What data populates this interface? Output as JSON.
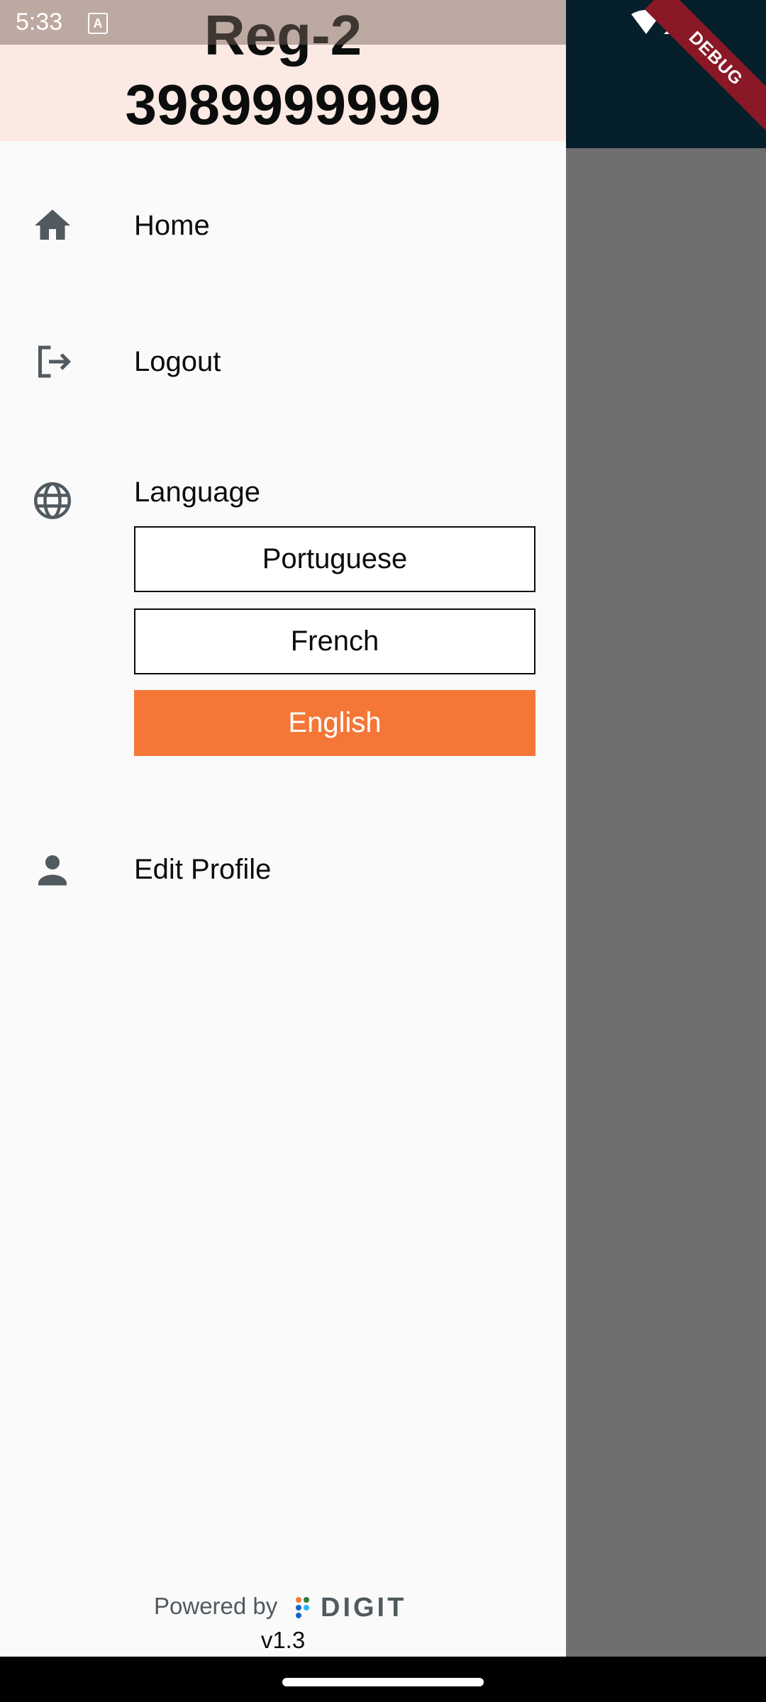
{
  "status_bar": {
    "time": "5:33",
    "notification_icon": "a-icon",
    "wifi_icon": "wifi-icon",
    "signal_icon": "signal-icon"
  },
  "debug_banner": "DEBUG",
  "drawer": {
    "header": {
      "name": "Reg-2",
      "phone": "3989999999"
    },
    "menu": {
      "home": {
        "label": "Home",
        "icon": "home-icon"
      },
      "logout": {
        "label": "Logout",
        "icon": "logout-icon"
      },
      "language": {
        "label": "Language",
        "icon": "globe-icon"
      },
      "edit_profile": {
        "label": "Edit Profile",
        "icon": "person-icon"
      }
    },
    "languages": {
      "options": [
        "Portuguese",
        "French",
        "English"
      ],
      "selected": "English"
    },
    "footer": {
      "powered_by": "Powered by",
      "brand": "DIGIT",
      "version": "v1.3"
    }
  },
  "colors": {
    "app_bar": "#06202b",
    "drawer_header": "#fbe9e3",
    "accent": "#f47738",
    "text": "#0b0c0c",
    "icon": "#505a5f",
    "scrim": "#6f6f6f"
  }
}
